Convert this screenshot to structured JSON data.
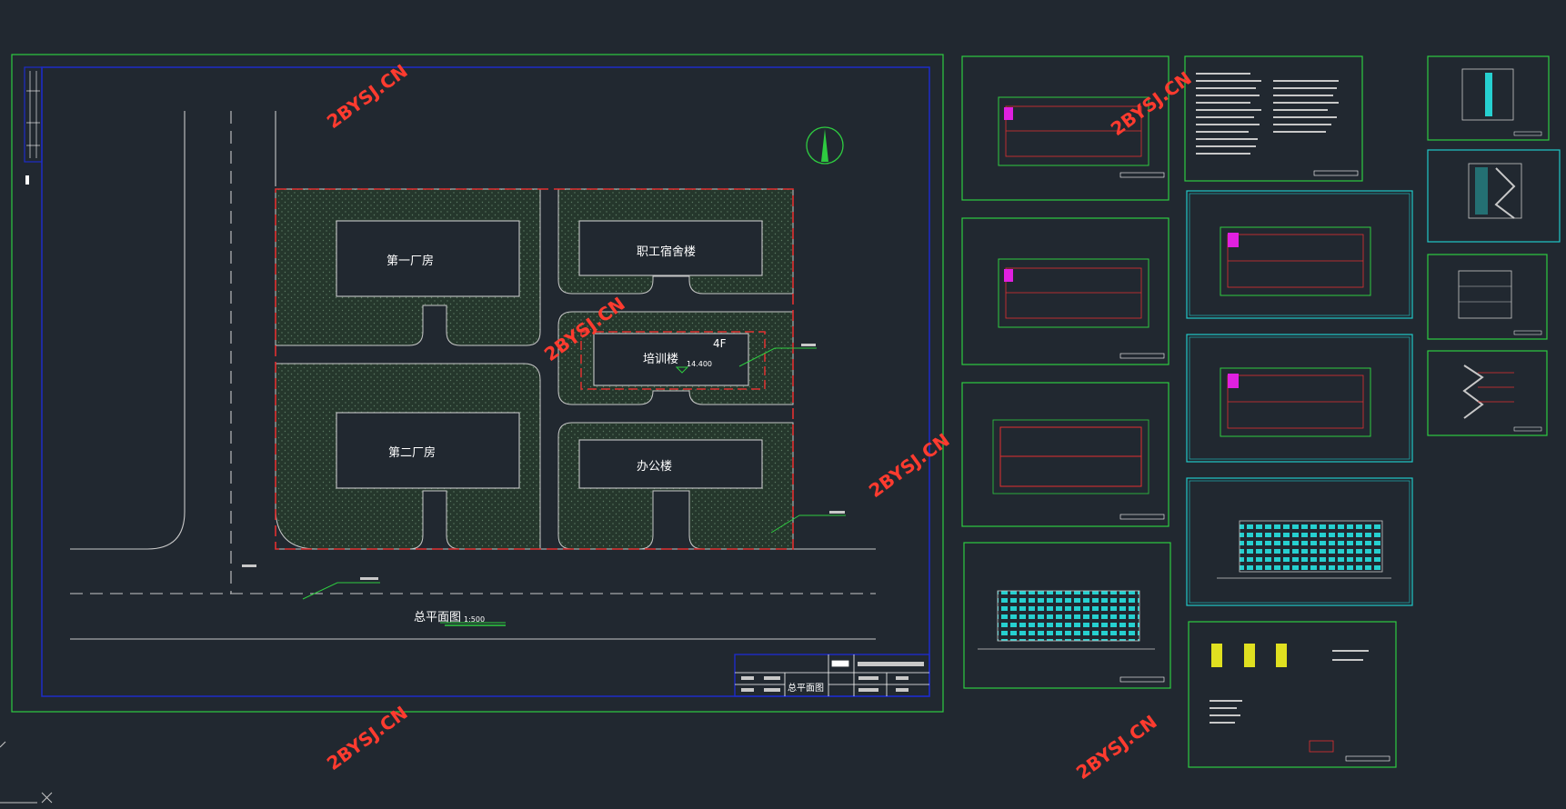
{
  "site_plan": {
    "buildings": [
      {
        "id": "plant-1",
        "label": "第一厂房"
      },
      {
        "id": "dormitory",
        "label": "职工宿舍楼"
      },
      {
        "id": "training",
        "label": "培训楼"
      },
      {
        "id": "plant-2",
        "label": "第二厂房"
      },
      {
        "id": "office",
        "label": "办公楼"
      }
    ],
    "training_floors": "4F",
    "training_elevation": "14.400",
    "title": "总平面图",
    "scale": "1:500"
  },
  "watermark": "2BYSJ.CN",
  "title_block": {
    "drawing_name": "总平面图"
  },
  "colors": {
    "bg": "#212830",
    "frame": "#2ecc40",
    "inner": "#1d2cc8",
    "redline": "#e23030",
    "green": "#1ed81e",
    "cyan": "#20c8c8"
  },
  "icons": {
    "north": "north-arrow-icon",
    "ucs": "ucs-icon"
  }
}
